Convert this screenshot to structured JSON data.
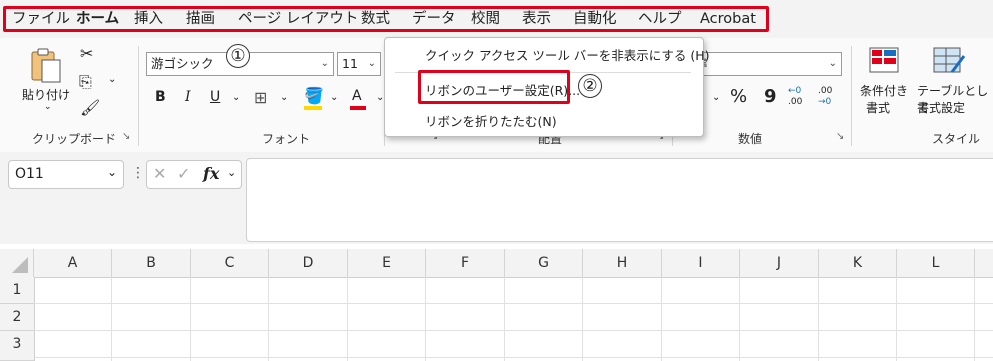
{
  "tabs": [
    "ファイル",
    "ホーム",
    "挿入",
    "描画",
    "ページ レイアウト",
    "数式",
    "データ",
    "校閲",
    "表示",
    "自動化",
    "ヘルプ",
    "Acrobat"
  ],
  "active_tab": "ホーム",
  "clipboard": {
    "paste_label": "貼り付け",
    "group_label": "クリップボード"
  },
  "font": {
    "name": "游ゴシック",
    "size": "11",
    "bold": "B",
    "italic": "I",
    "underline": "U",
    "font_color_glyph": "A",
    "group_label": "フォント"
  },
  "alignment": {
    "group_label": "配置"
  },
  "number": {
    "format": "準",
    "percent": "%",
    "comma": "9",
    "inc_decimal_top": "←0",
    "inc_decimal_bottom": ".00",
    "dec_decimal_top": ".00",
    "dec_decimal_bottom": "→0",
    "group_label": "数値"
  },
  "styles": {
    "conditional_l1": "条件付き",
    "conditional_l2": "書式",
    "table_l1": "テーブルとして",
    "table_l2": "書式設定",
    "group_label": "スタイル"
  },
  "context_menu": {
    "items": [
      "クイック アクセス ツール バーを非表示にする (H)",
      "リボンのユーザー設定(R)...",
      "リボンを折りたたむ(N)"
    ]
  },
  "callouts": [
    "①",
    "②"
  ],
  "formula_bar": {
    "name_box": "O11",
    "fx": "fx"
  },
  "columns": [
    "A",
    "B",
    "C",
    "D",
    "E",
    "F",
    "G",
    "H",
    "I",
    "J",
    "K",
    "L"
  ],
  "rows": [
    "1",
    "2",
    "3"
  ],
  "colors": {
    "outline": "#e0001a",
    "accent": "#1f6e3d"
  }
}
